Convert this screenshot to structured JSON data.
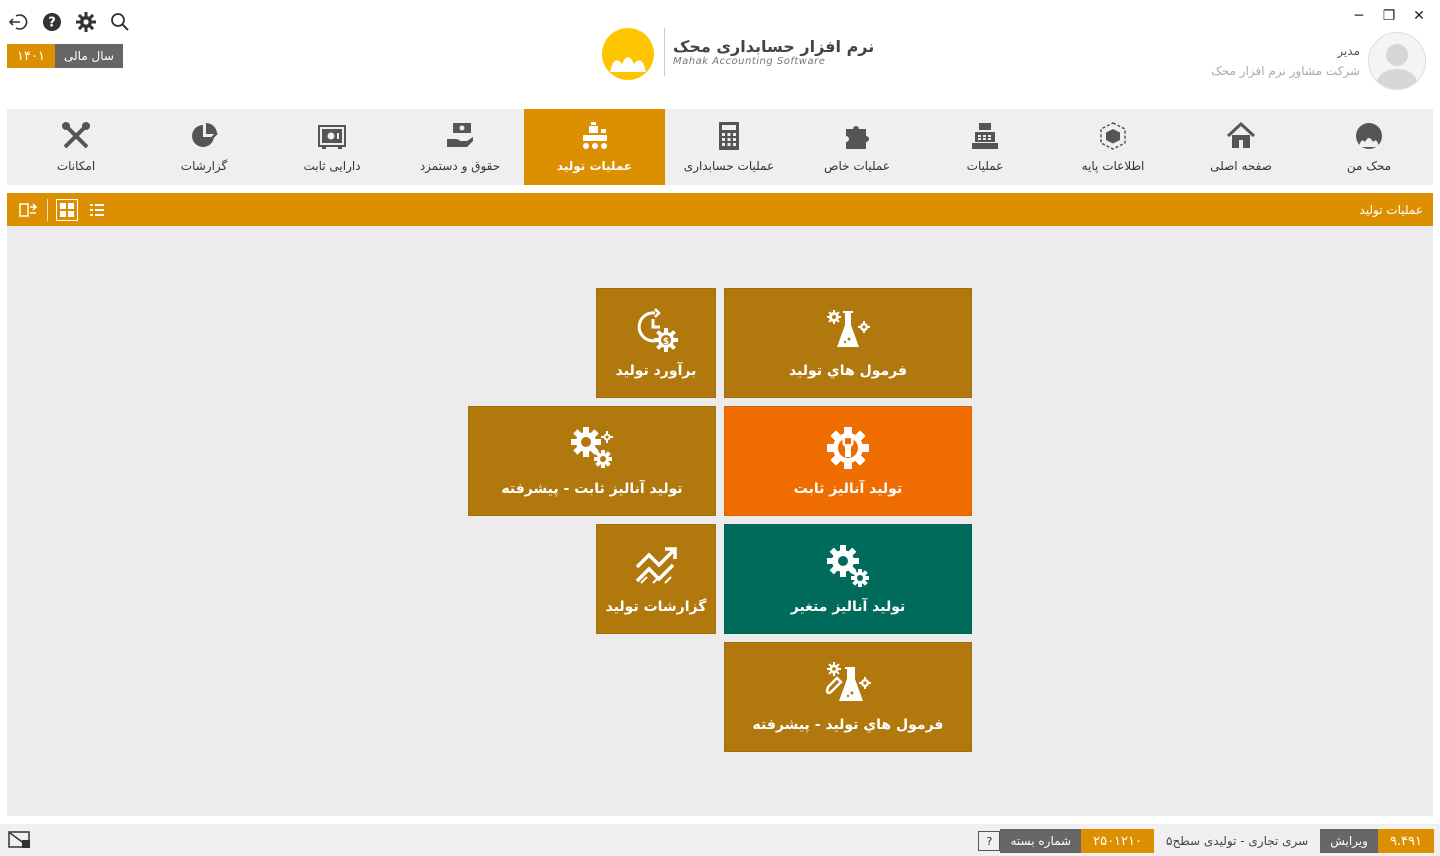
{
  "window": {
    "minimize": "─",
    "restore": "❐",
    "close": "✕"
  },
  "fiscal": {
    "label": "سال مالی",
    "year": "۱۴۰۱"
  },
  "logo": {
    "title_fa": "نرم افزار حسابداری محک",
    "title_en": "Mahak Accounting Software"
  },
  "user": {
    "name": "مدیر",
    "company": "شرکت مشاور نرم افزار محک"
  },
  "nav": [
    {
      "key": "mahak-man",
      "label": "محک من",
      "icon": "mahak-logo-icon",
      "active": false
    },
    {
      "key": "home",
      "label": "صفحه اصلی",
      "icon": "home-icon",
      "active": false
    },
    {
      "key": "base-info",
      "label": "اطلاعات پایه",
      "icon": "cube-icon",
      "active": false
    },
    {
      "key": "operations",
      "label": "عملیات",
      "icon": "cash-register-icon",
      "active": false
    },
    {
      "key": "special-ops",
      "label": "عملیات خاص",
      "icon": "puzzle-icon",
      "active": false
    },
    {
      "key": "accounting-ops",
      "label": "عملیات حسابداری",
      "icon": "calculator-icon",
      "active": false
    },
    {
      "key": "production-ops",
      "label": "عملیات تولید",
      "icon": "production-line-icon",
      "active": true
    },
    {
      "key": "payroll",
      "label": "حقوق و دستمزد",
      "icon": "hand-money-icon",
      "active": false
    },
    {
      "key": "fixed-assets",
      "label": "دارایی ثابت",
      "icon": "safe-icon",
      "active": false
    },
    {
      "key": "reports",
      "label": "گزارشات",
      "icon": "pie-chart-icon",
      "active": false
    },
    {
      "key": "facilities",
      "label": "امکانات",
      "icon": "tools-icon",
      "active": false
    }
  ],
  "section": {
    "title": "عملیات تولید"
  },
  "tiles": {
    "production_formulas": "فرمول هاي توليد",
    "production_estimate": "برآورد تولید",
    "fixed_analysis": "تولید آنالیز ثابت",
    "fixed_analysis_advanced": "تولید آنالیز ثابت - پیشرفته",
    "variable_analysis": "تولید آنالیز متغیر",
    "production_reports": "گزارشات تولید",
    "production_formulas_advanced": "فرمول هاي توليد - پیشرفته"
  },
  "status": {
    "help": "?",
    "package_label": "شماره بسته",
    "package_number": "۲۵۰۱۲۱۰",
    "series": "سری تجاری - تولیدی سطح۵",
    "edition_label": "ویرایش",
    "edition_value": "۹.۴۹۱"
  },
  "colors": {
    "accent": "#dc8f00",
    "tile_gold": "#b0780d",
    "tile_orange": "#ef6d00",
    "tile_teal": "#006b5b"
  }
}
